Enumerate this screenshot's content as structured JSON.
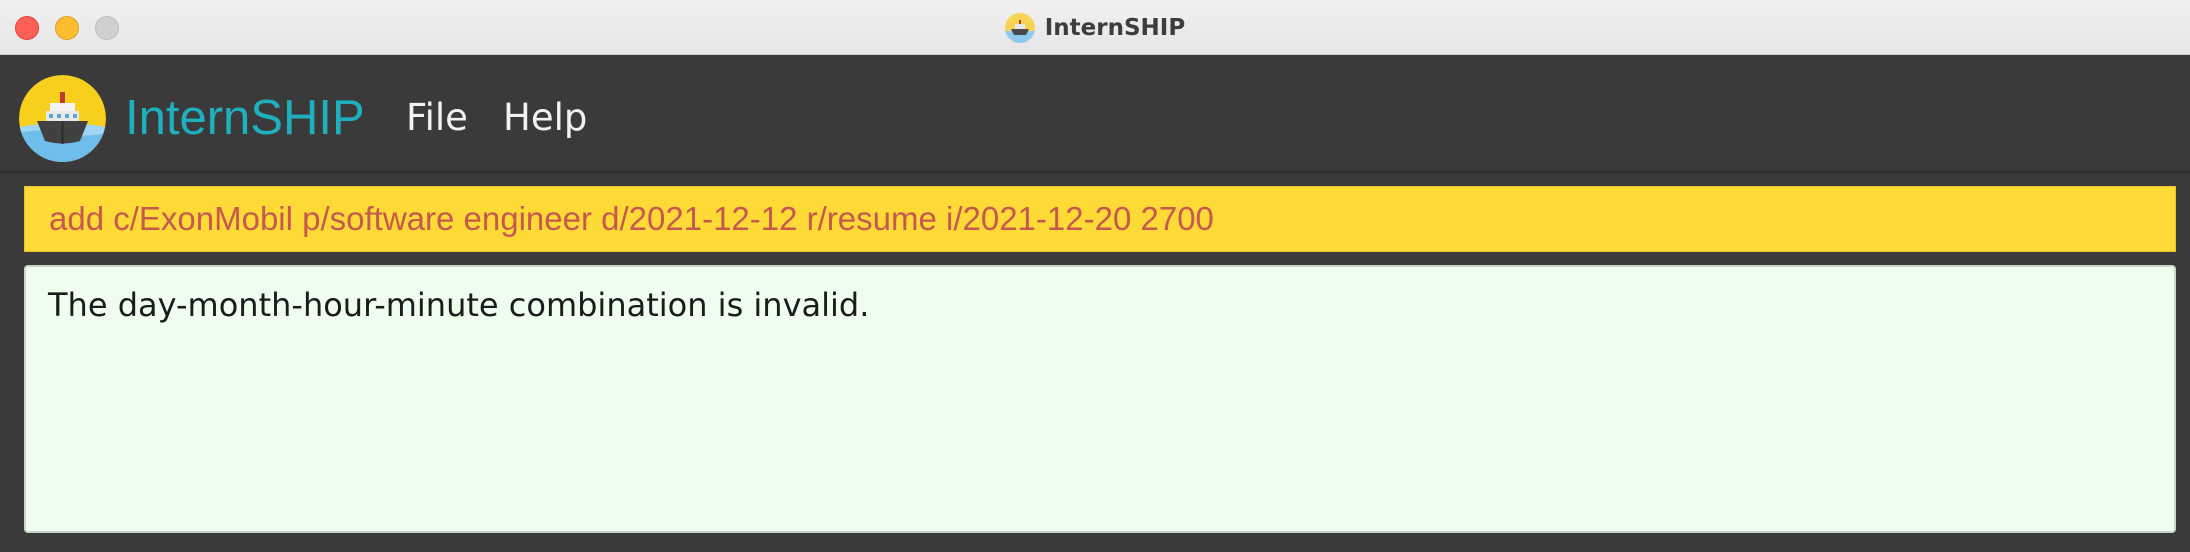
{
  "window": {
    "title": "InternSHIP",
    "app_icon": "ship-icon"
  },
  "header": {
    "app_name": "InternSHIP",
    "logo_icon": "ship-logo-icon",
    "menu": [
      {
        "label": "File"
      },
      {
        "label": "Help"
      }
    ]
  },
  "command": {
    "value": "add c/ExonMobil p/software engineer d/2021-12-12 r/resume i/2021-12-20 2700"
  },
  "result": {
    "message": "The day-month-hour-minute combination is invalid."
  },
  "colors": {
    "accent": "#1fb0c0",
    "command_bg": "#fdda36",
    "command_text": "#c7584f",
    "result_bg": "#eefdee",
    "app_bg": "#3a3a3a"
  }
}
